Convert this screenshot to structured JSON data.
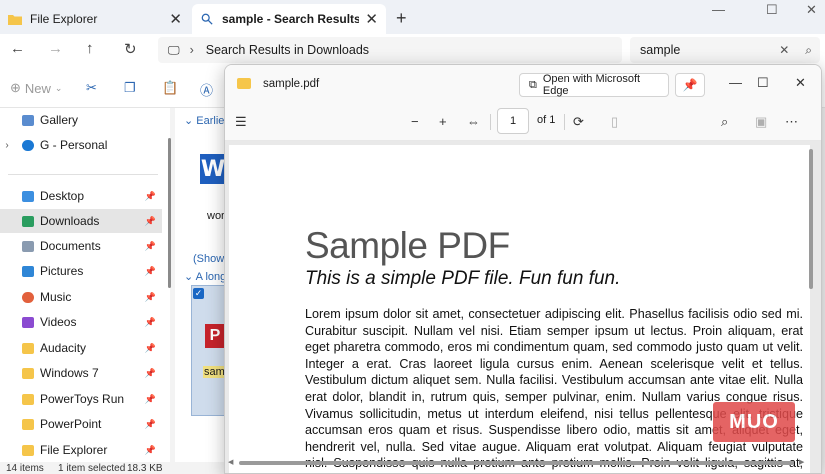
{
  "tabs": [
    {
      "label": "File Explorer"
    },
    {
      "label": "sample - Search Results in Dow"
    }
  ],
  "address": {
    "breadcrumb": "Search Results in Downloads"
  },
  "search": {
    "value": "sample"
  },
  "command_bar": {
    "new_label": "New"
  },
  "sidebar": {
    "items": [
      {
        "label": "Gallery"
      },
      {
        "label": "G - Personal"
      },
      {
        "label": "Desktop"
      },
      {
        "label": "Downloads"
      },
      {
        "label": "Documents"
      },
      {
        "label": "Pictures"
      },
      {
        "label": "Music"
      },
      {
        "label": "Videos"
      },
      {
        "label": "Audacity"
      },
      {
        "label": "Windows 7"
      },
      {
        "label": "PowerToys Run"
      },
      {
        "label": "PowerPoint"
      },
      {
        "label": "File Explorer"
      }
    ]
  },
  "main": {
    "group1": "Earlier",
    "word_file": "wor",
    "show_all": "(Show a",
    "group2": "A long",
    "selected_file": "sam",
    "word_badge": "W",
    "pdf_badge": "P"
  },
  "status": {
    "items": "14 items",
    "selected": "1 item selected",
    "size": "18.3 KB"
  },
  "pdf": {
    "filename": "sample.pdf",
    "open_edge": "Open with Microsoft Edge",
    "page_current": "1",
    "page_total": "of 1",
    "title": "Sample PDF",
    "subtitle": "This is a simple PDF file. Fun fun fun.",
    "body": "Lorem ipsum dolor sit amet, consectetuer adipiscing elit. Phasellus facilisis odio sed mi. Curabitur suscipit. Nullam vel nisi. Etiam semper ipsum ut lectus. Proin aliquam, erat eget pharetra commodo, eros mi condimentum quam, sed commodo justo quam ut velit. Integer a erat. Cras laoreet ligula cursus enim. Aenean scelerisque velit et tellus. Vestibulum dictum aliquet sem. Nulla facilisi. Vestibulum accumsan ante vitae elit. Nulla erat dolor, blandit in, rutrum quis, semper pulvinar, enim. Nullam varius congue risus. Vivamus sollicitudin, metus ut interdum eleifend, nisi tellus pellentesque elit, tristique accumsan eros quam et risus. Suspendisse libero odio, mattis sit amet, aliquet eget, hendrerit vel, nulla. Sed vitae augue. Aliquam erat volutpat. Aliquam feugiat vulputate nisl. Suspendisse quis nulla pretium ante pretium mollis. Proin velit ligula, sagittis at, egestas a,"
  },
  "watermark": "MUO",
  "colors": {
    "accent": "#1a67c4",
    "pdf_red": "#c6232b",
    "word_blue": "#1f5fbf"
  }
}
